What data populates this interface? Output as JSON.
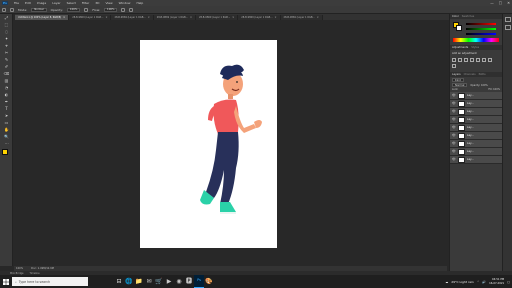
{
  "app": {
    "logo": "Ps",
    "menus": [
      "File",
      "Edit",
      "Image",
      "Layer",
      "Select",
      "Filter",
      "3D",
      "View",
      "Window",
      "Help"
    ],
    "window_controls": [
      "—",
      "□",
      "✕"
    ]
  },
  "options": {
    "mode_label": "Mode:",
    "mode_value": "Normal",
    "opacity_label": "Opacity:",
    "opacity_value": "100%",
    "flow_label": "Flow:",
    "flow_value": "100%"
  },
  "tabs": [
    {
      "label": "Untitled-1 @ 100% (Layer 8, RGB/8)",
      "active": true
    },
    {
      "label": "28-B-9869 (Layer 1 RGB...",
      "active": false
    },
    {
      "label": "28-B-9869 (Layer 1 RGB...",
      "active": false
    },
    {
      "label": "28-B-9869 (Layer 1 RGB...",
      "active": false
    },
    {
      "label": "28-B-9869 (Layer 1 RGB...",
      "active": false
    },
    {
      "label": "28-B-9869 (Layer 1 RGB...",
      "active": false
    },
    {
      "label": "28-B-9869 (Layer 1 RGB...",
      "active": false
    },
    {
      "label": "28-B-9869 (Layer 1 RGB...",
      "active": false
    }
  ],
  "tools": [
    "⤢",
    "⬚",
    "◌",
    "✦",
    "⌖",
    "✂",
    "✎",
    "✐",
    "⌫",
    "▥",
    "◔",
    "◐",
    "✒",
    "T",
    "➤",
    "▭",
    "✋",
    "🔍",
    "⋯"
  ],
  "status": {
    "zoom": "100%",
    "doc": "Doc: 1.49M/12.9M"
  },
  "timeline": {
    "tab1": "Mini Bridge",
    "tab2": "Timeline"
  },
  "panels": {
    "color_tabs": [
      "Color",
      "Swatches"
    ],
    "adjust_tabs": [
      "Adjustments",
      "Styles"
    ],
    "adjust_hint": "Add an adjustment",
    "layers_tabs": [
      "Layers",
      "Channels",
      "Paths"
    ],
    "kind_label": "Kind",
    "blend_label": "Normal",
    "opacity_label": "Opacity: 100%",
    "lock_label": "Lock:",
    "fill_label": "Fill: 100%",
    "layers": [
      "Lay...",
      "Lay...",
      "Lay...",
      "Lay...",
      "Lay...",
      "Lay...",
      "Lay...",
      "Lay...",
      "Lay..."
    ],
    "swatch_colors": [
      "#ffd400",
      "#ffffff",
      "#ff6a6a",
      "#6ad06a",
      "#6a8aff"
    ]
  },
  "taskbar": {
    "search_placeholder": "Type here to search",
    "apps": [
      "⊟",
      "🌐",
      "📁",
      "✉",
      "🛒",
      "▶",
      "◉",
      "🅿",
      "Ps",
      "🎨"
    ],
    "weather": "29°C  Light rain",
    "time": "04:51 PM",
    "date": "16-07-2021"
  }
}
